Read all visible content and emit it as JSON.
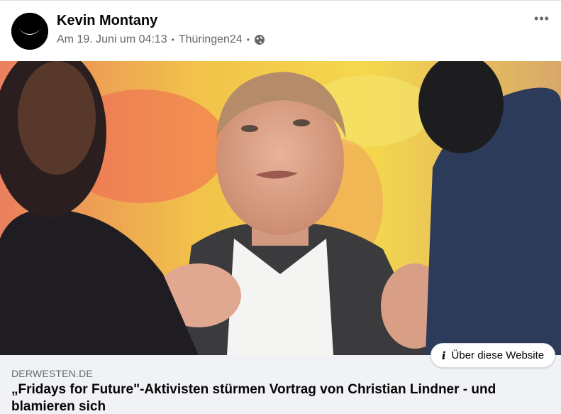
{
  "post": {
    "author": "Kevin Montany",
    "timestamp": "Am 19. Juni um 04:13",
    "separator": "•",
    "source": "Thüringen24",
    "privacy_icon": "globe-icon",
    "more_label": "•••"
  },
  "link": {
    "domain": "DERWESTEN.DE",
    "headline": "„Fridays for Future\"-Aktivisten stürmen Vortrag von Christian Lindner - und blamieren sich",
    "about_label": "Über diese Website",
    "about_icon": "info-icon"
  },
  "colors": {
    "secondary_text": "#65676b",
    "preview_bg": "#f0f2f5"
  }
}
